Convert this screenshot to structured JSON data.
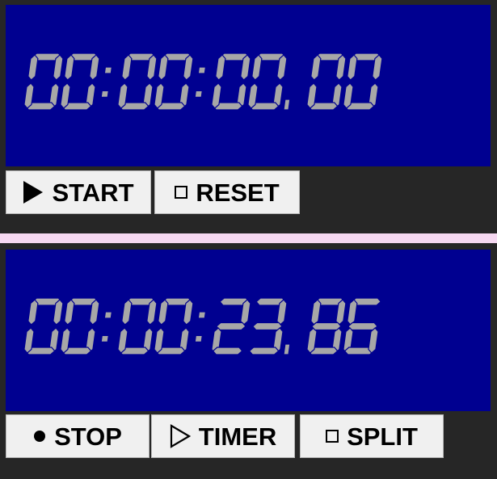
{
  "stopwatch_1": {
    "display": {
      "time": "00:00:00.00"
    },
    "buttons": [
      {
        "label": "START",
        "icon": "play-icon"
      },
      {
        "label": "RESET",
        "icon": "square-icon"
      }
    ]
  },
  "stopwatch_2": {
    "display": {
      "time": "00:00:23.86"
    },
    "buttons": [
      {
        "label": "STOP",
        "icon": "dot-icon"
      },
      {
        "label": "TIMER",
        "icon": "play-outline-icon"
      },
      {
        "label": "SPLIT",
        "icon": "square-icon"
      }
    ]
  },
  "colors": {
    "display_bg": "#000090",
    "segment": "#a7a7a7",
    "divider": "#f6d8f1",
    "button_bg": "#f0f0f0",
    "app_bg": "#262626"
  }
}
